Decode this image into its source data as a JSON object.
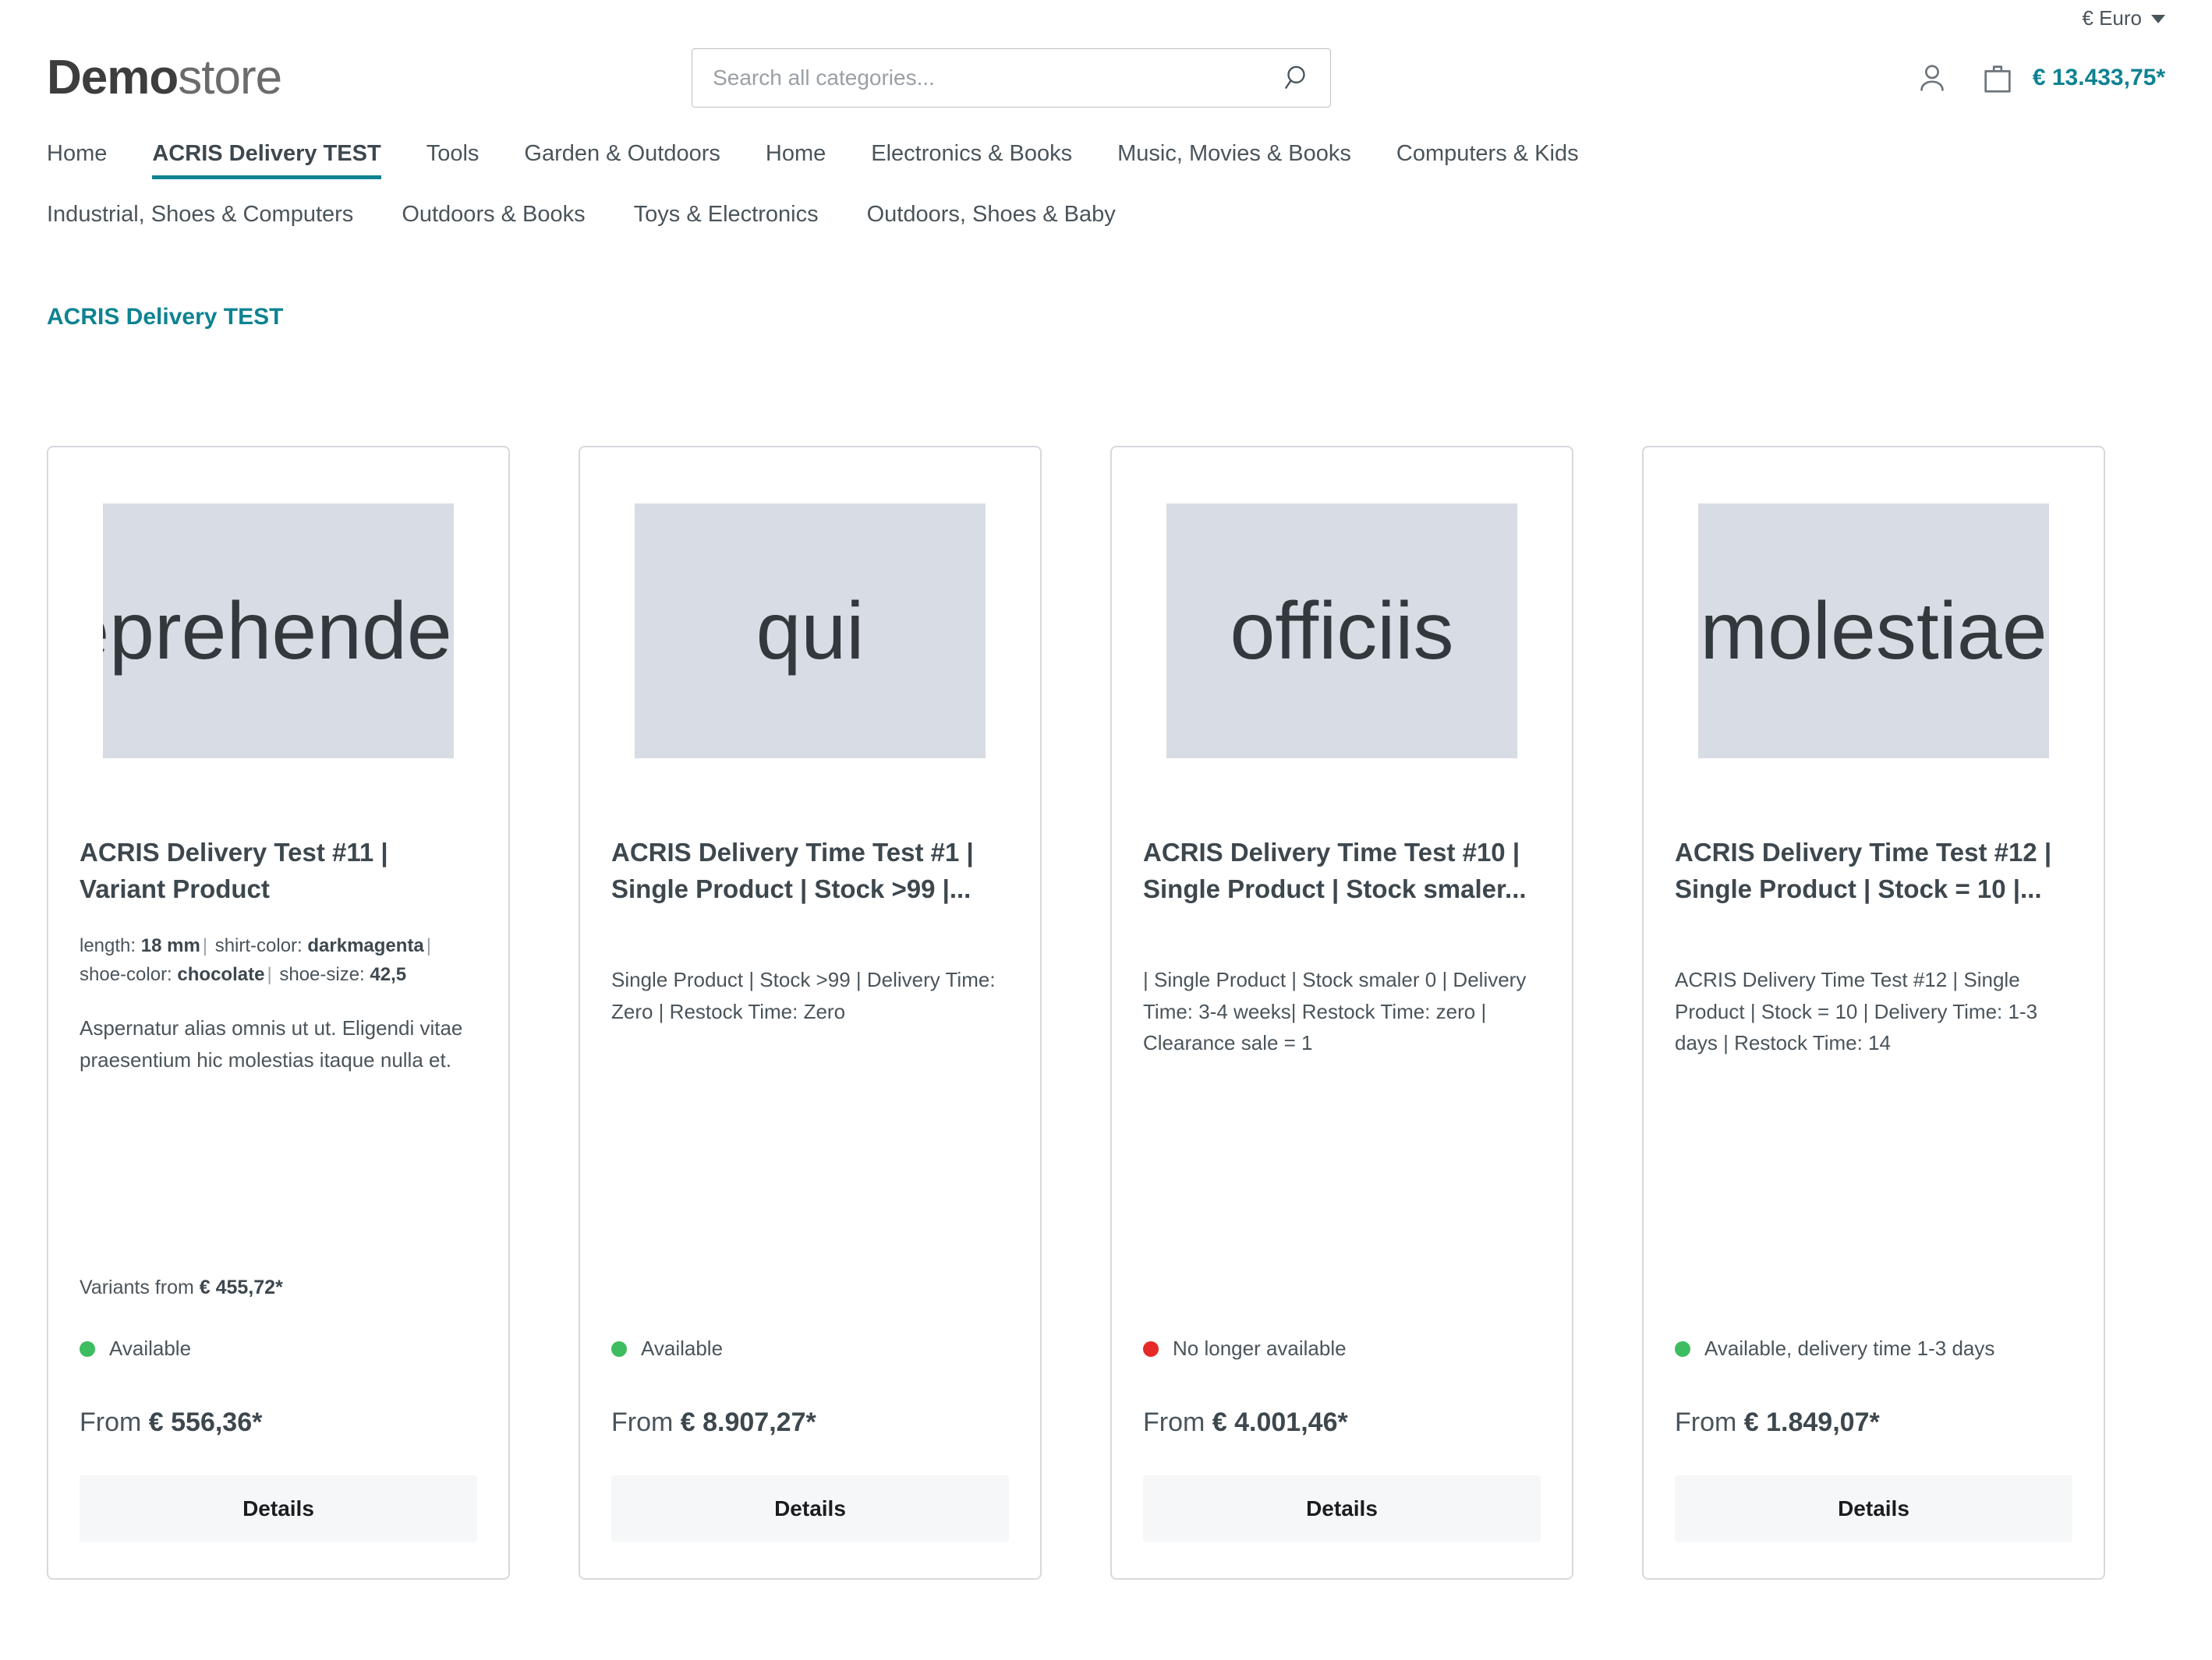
{
  "topbar": {
    "currency_label": "€ Euro",
    "caret_icon": "chevron-down-icon"
  },
  "header": {
    "logo_bold": "Demo",
    "logo_light": "store",
    "search": {
      "value": "",
      "placeholder": "Search all categories...",
      "icon": "search-icon"
    },
    "account_icon": "user-icon",
    "cart_icon": "shopping-bag-icon",
    "cart_amount": "€ 13.433,75*"
  },
  "nav": {
    "row1": [
      {
        "label": "Home",
        "active": false
      },
      {
        "label": "ACRIS Delivery TEST",
        "active": true
      },
      {
        "label": "Tools",
        "active": false
      },
      {
        "label": "Garden & Outdoors",
        "active": false
      },
      {
        "label": "Home",
        "active": false
      },
      {
        "label": "Electronics & Books",
        "active": false
      },
      {
        "label": "Music, Movies & Books",
        "active": false
      },
      {
        "label": "Computers & Kids",
        "active": false
      }
    ],
    "row2": [
      {
        "label": "Industrial, Shoes & Computers",
        "active": false
      },
      {
        "label": "Outdoors & Books",
        "active": false
      },
      {
        "label": "Toys & Electronics",
        "active": false
      },
      {
        "label": "Outdoors, Shoes & Baby",
        "active": false
      }
    ]
  },
  "page": {
    "title": "ACRIS Delivery TEST"
  },
  "products": [
    {
      "image_text": "reprehenderit",
      "title": "ACRIS Delivery Test #11 | Variant Product",
      "variants_line_1_label_a": "length:",
      "variants_line_1_value_a": "18 mm",
      "variants_line_1_label_b": "shirt-color:",
      "variants_line_1_value_b": "darkmagenta",
      "variants_line_2_label_a": "shoe-color:",
      "variants_line_2_value_a": "chocolate",
      "variants_line_2_label_b": "shoe-size:",
      "variants_line_2_value_b": "42,5",
      "description": "Aspernatur alias omnis ut ut. Eligendi vitae praesentium hic molestias itaque nulla et.",
      "variants_from_label": "Variants from",
      "variants_from_price": "€ 455,72*",
      "availability": "Available",
      "availability_state": "green",
      "price_prefix": "From",
      "price": "€ 556,36*",
      "details_label": "Details"
    },
    {
      "image_text": "qui",
      "title": "ACRIS Delivery Time Test #1 | Single Product | Stock >99 |...",
      "description": "Single Product | Stock >99 | Delivery Time: Zero | Restock Time: Zero",
      "availability": "Available",
      "availability_state": "green",
      "price_prefix": "From",
      "price": "€ 8.907,27*",
      "details_label": "Details"
    },
    {
      "image_text": "officiis",
      "title": "ACRIS Delivery Time Test #10 | Single Product | Stock smaler...",
      "description": "| Single Product | Stock smaler 0 | Delivery Time: 3-4 weeks| Restock Time: zero | Clearance sale = 1",
      "availability": "No longer available",
      "availability_state": "red",
      "price_prefix": "From",
      "price": "€ 4.001,46*",
      "details_label": "Details"
    },
    {
      "image_text": "molestiae",
      "title": "ACRIS Delivery Time Test #12 | Single Product | Stock = 10 |...",
      "description": "ACRIS Delivery Time Test #12 | Single Product | Stock = 10 | Delivery Time: 1-3 days | Restock Time: 14",
      "availability": "Available, delivery time 1-3 days",
      "availability_state": "green",
      "price_prefix": "From",
      "price": "€ 1.849,07*",
      "details_label": "Details"
    }
  ],
  "colors": {
    "accent_teal": "#0e8391",
    "available_green": "#3dbd5f",
    "unavailable_red": "#e52b28",
    "placeholder_bg": "#d8dce4",
    "card_border": "#d6d9dd"
  }
}
